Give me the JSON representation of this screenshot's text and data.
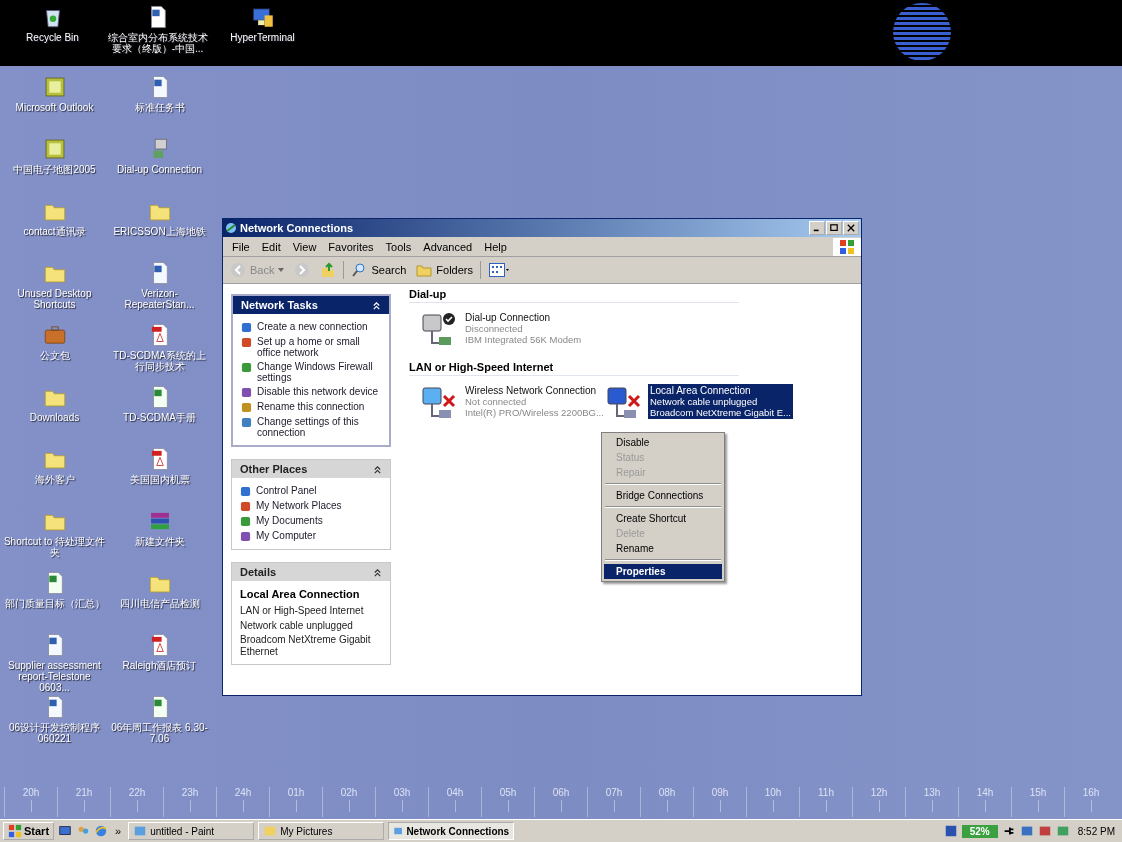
{
  "top_icons": [
    {
      "label": "Recycle Bin",
      "kind": "recycle"
    },
    {
      "label": "综合室内分布系统技术要求（终版）-中国...",
      "kind": "doc"
    },
    {
      "label": "HyperTerminal",
      "kind": "computer"
    }
  ],
  "desktop_icons": [
    {
      "label": "Microsoft Outlook",
      "kind": "app"
    },
    {
      "label": "标准任务书",
      "kind": "doc"
    },
    {
      "label": "中国电子地图2005",
      "kind": "app"
    },
    {
      "label": "Dial-up Connection",
      "kind": "computer"
    },
    {
      "label": "contact通讯录",
      "kind": "folder"
    },
    {
      "label": "ERICSSON上海地铁",
      "kind": "folder"
    },
    {
      "label": "Unused Desktop Shortcuts",
      "kind": "folder"
    },
    {
      "label": "Verizon-RepeaterStan...",
      "kind": "doc"
    },
    {
      "label": "公文包",
      "kind": "briefcase"
    },
    {
      "label": "TD-SCDMA系统的上行同步技术",
      "kind": "pdf"
    },
    {
      "label": "Downloads",
      "kind": "folder"
    },
    {
      "label": "TD-SCDMA手册",
      "kind": "xls"
    },
    {
      "label": "海外客户",
      "kind": "folder"
    },
    {
      "label": "美国国内机票",
      "kind": "pdf"
    },
    {
      "label": "Shortcut to 待处理文件夹",
      "kind": "folder"
    },
    {
      "label": "新建文件夹",
      "kind": "archive"
    },
    {
      "label": "部门质量目标（汇总）",
      "kind": "xls"
    },
    {
      "label": "四川电信产品检测",
      "kind": "folder"
    },
    {
      "label": "Supplier assessment report-Telestone 0603...",
      "kind": "doc"
    },
    {
      "label": "Raleigh酒店预订",
      "kind": "pdf"
    },
    {
      "label": "06设计开发控制程序 060221",
      "kind": "doc"
    },
    {
      "label": "06年周工作报表 6.30-7.06",
      "kind": "xls"
    }
  ],
  "timeline": [
    "20h",
    "21h",
    "22h",
    "23h",
    "24h",
    "01h",
    "02h",
    "03h",
    "04h",
    "05h",
    "06h",
    "07h",
    "08h",
    "09h",
    "10h",
    "11h",
    "12h",
    "13h",
    "14h",
    "15h",
    "16h"
  ],
  "window": {
    "title": "Network Connections",
    "menu": [
      "File",
      "Edit",
      "View",
      "Favorites",
      "Tools",
      "Advanced",
      "Help"
    ],
    "toolbar": {
      "back": "Back",
      "search": "Search",
      "folders": "Folders"
    },
    "panels": [
      {
        "title": "Network Tasks",
        "kind": "special",
        "expanded": true,
        "items": [
          "Create a new connection",
          "Set up a home or small office network",
          "Change Windows Firewall settings",
          "Disable this network device",
          "Rename this connection",
          "Change settings of this connection"
        ]
      },
      {
        "title": "Other Places",
        "kind": "normal",
        "expanded": true,
        "items": [
          "Control Panel",
          "My Network Places",
          "My Documents",
          "My Computer"
        ]
      },
      {
        "title": "Details",
        "kind": "details",
        "expanded": true,
        "heading": "Local Area Connection",
        "items": [
          "LAN or High-Speed Internet",
          "Network cable unplugged",
          "Broadcom NetXtreme Gigabit Ethernet"
        ]
      }
    ],
    "groups": [
      {
        "title": "Dial-up",
        "connections": [
          {
            "name": "Dial-up Connection",
            "status": "Disconnected",
            "device": "IBM Integrated 56K Modem",
            "kind": "dialup",
            "default": true,
            "unplugged": false,
            "selected": false
          }
        ]
      },
      {
        "title": "LAN or High-Speed Internet",
        "connections": [
          {
            "name": "Wireless Network Connection",
            "status": "Not connected",
            "device": "Intel(R) PRO/Wireless 2200BG...",
            "kind": "wireless",
            "default": false,
            "unplugged": true,
            "selected": false
          },
          {
            "name": "Local Area Connection",
            "status": "Network cable unplugged",
            "device": "Broadcom NetXtreme Gigabit E...",
            "kind": "lan",
            "default": false,
            "unplugged": true,
            "selected": true
          }
        ]
      }
    ]
  },
  "context_menu": [
    [
      {
        "label": "Disable",
        "disabled": false,
        "selected": false
      },
      {
        "label": "Status",
        "disabled": true,
        "selected": false
      },
      {
        "label": "Repair",
        "disabled": true,
        "selected": false
      }
    ],
    [
      {
        "label": "Bridge Connections",
        "disabled": false,
        "selected": false
      }
    ],
    [
      {
        "label": "Create Shortcut",
        "disabled": false,
        "selected": false
      },
      {
        "label": "Delete",
        "disabled": true,
        "selected": false
      },
      {
        "label": "Rename",
        "disabled": false,
        "selected": false
      }
    ],
    [
      {
        "label": "Properties",
        "disabled": false,
        "selected": true
      }
    ]
  ],
  "taskbar": {
    "start": "Start",
    "more": "»",
    "tasks": [
      {
        "label": "untitled - Paint",
        "selected": false
      },
      {
        "label": "My Pictures",
        "selected": false
      },
      {
        "label": "Network Connections",
        "selected": true
      }
    ],
    "battery": "52%",
    "clock": "8:52 PM"
  }
}
